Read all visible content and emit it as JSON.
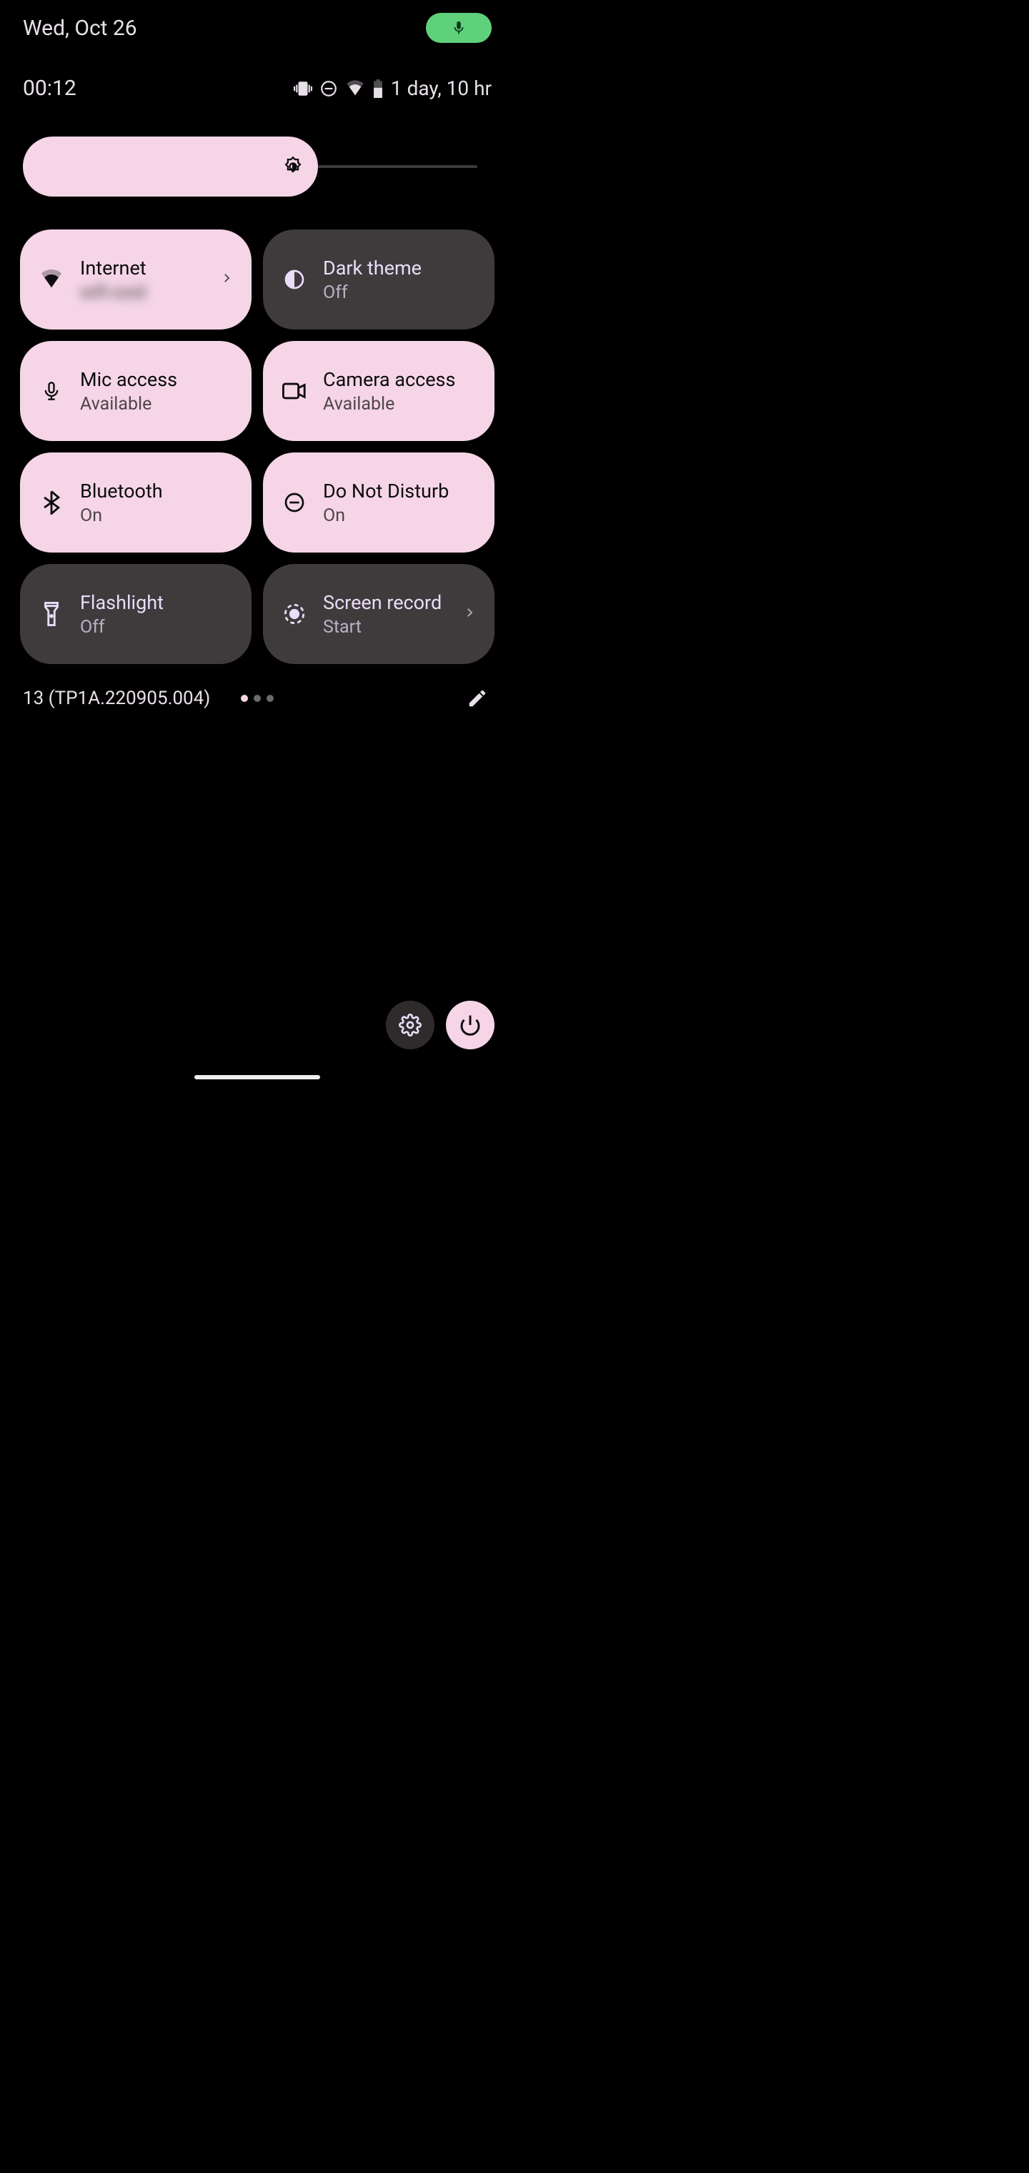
{
  "header": {
    "date": "Wed, Oct 26",
    "clock": "00:12",
    "battery_text": "1 day, 10 hr"
  },
  "brightness": {
    "percent": 63
  },
  "tiles": [
    {
      "title": "Internet",
      "sub": "wifi-ssid",
      "on": true,
      "icon": "wifi",
      "chevron": true,
      "blurred_sub": true
    },
    {
      "title": "Dark theme",
      "sub": "Off",
      "on": false,
      "icon": "darktheme",
      "chevron": false
    },
    {
      "title": "Mic access",
      "sub": "Available",
      "on": true,
      "icon": "mic",
      "chevron": false
    },
    {
      "title": "Camera access",
      "sub": "Available",
      "on": true,
      "icon": "camera",
      "chevron": false
    },
    {
      "title": "Bluetooth",
      "sub": "On",
      "on": true,
      "icon": "bluetooth",
      "chevron": false
    },
    {
      "title": "Do Not Disturb",
      "sub": "On",
      "on": true,
      "icon": "dnd",
      "chevron": false
    },
    {
      "title": "Flashlight",
      "sub": "Off",
      "on": false,
      "icon": "flashlight",
      "chevron": false
    },
    {
      "title": "Screen record",
      "sub": "Start",
      "on": false,
      "icon": "record",
      "chevron": true
    }
  ],
  "footer": {
    "build": "13 (TP1A.220905.004)",
    "page_count": 3,
    "active_page": 0
  },
  "colors": {
    "tile_on": "#f5d5e6",
    "tile_off": "#3f3a3c",
    "mic_indicator": "#5fd17a"
  }
}
